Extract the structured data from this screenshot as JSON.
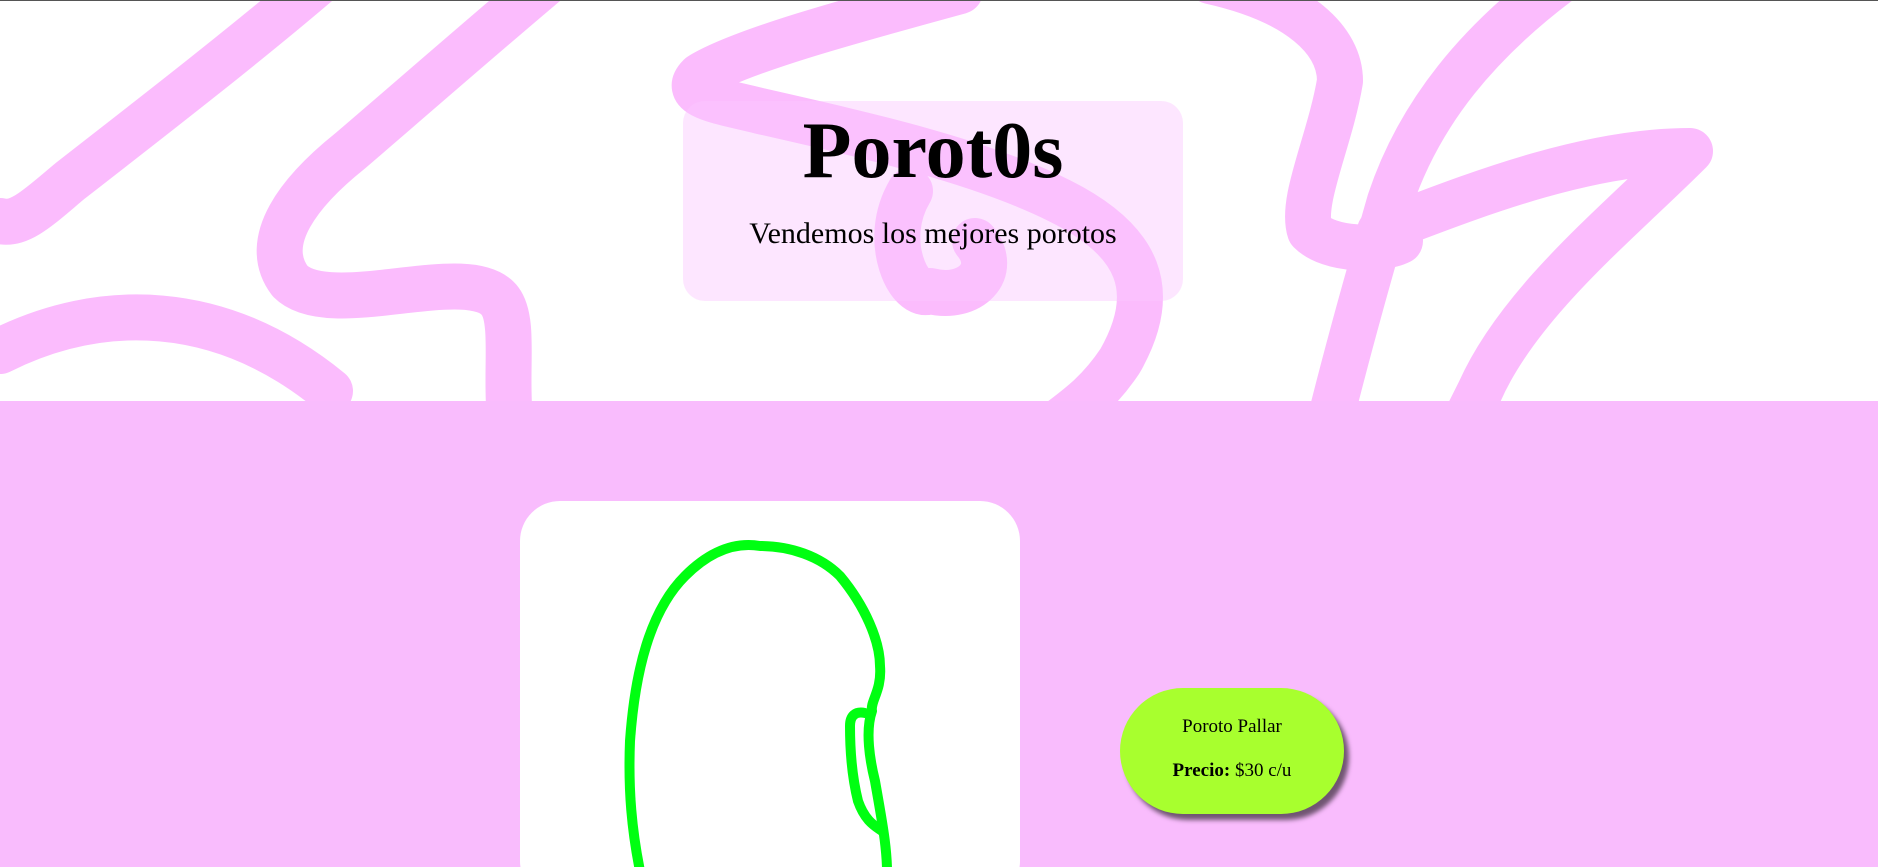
{
  "header": {
    "title": "Porot0s",
    "subtitle": "Vendemos los mejores porotos"
  },
  "product": {
    "name": "Poroto Pallar",
    "price_label": "Precio:",
    "price_value": "$30 c/u",
    "image_icon": "bean-drawing-icon"
  },
  "colors": {
    "hero_background": "#ffffff",
    "scribble_stroke": "#fbbcfd",
    "title_box": "#fde2ff",
    "products_background": "#f9bcfd",
    "card_background": "#ffffff",
    "bean_outline": "#00ff11",
    "info_pill": "#a8ff2e"
  }
}
